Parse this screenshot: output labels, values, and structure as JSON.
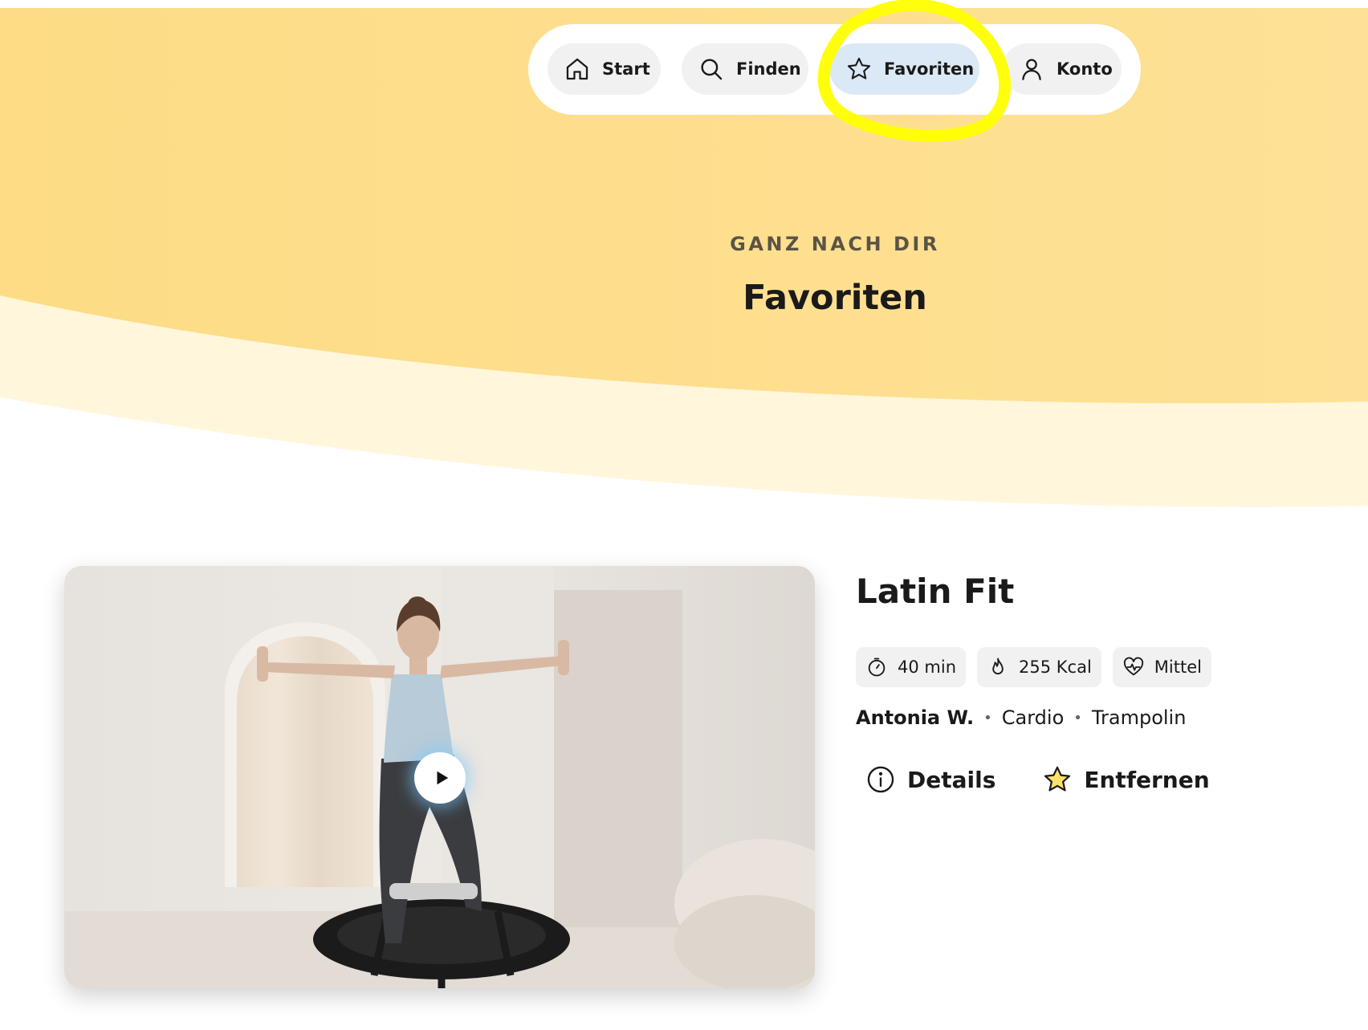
{
  "nav": {
    "items": [
      {
        "label": "Start",
        "icon": "home-icon",
        "active": false
      },
      {
        "label": "Finden",
        "icon": "search-icon",
        "active": false
      },
      {
        "label": "Favoriten",
        "icon": "star-icon",
        "active": true
      },
      {
        "label": "Konto",
        "icon": "user-icon",
        "active": false
      }
    ]
  },
  "hero": {
    "eyebrow": "GANZ NACH DIR",
    "title": "Favoriten"
  },
  "workout": {
    "title": "Latin Fit",
    "chips": [
      {
        "label": "40 min",
        "icon": "stopwatch-icon"
      },
      {
        "label": "255 Kcal",
        "icon": "flame-icon"
      },
      {
        "label": "Mittel",
        "icon": "heart-pulse-icon"
      }
    ],
    "trainer": "Antonia W.",
    "categories": [
      "Cardio",
      "Trampolin"
    ],
    "actions": {
      "details": "Details",
      "remove": "Entfernen"
    }
  },
  "colors": {
    "hero_yellow": "#fde08d",
    "hero_light": "#fff6dc",
    "nav_active": "#dbe9f6",
    "highlight": "#ffff00",
    "star_fill": "#ffe16b"
  }
}
